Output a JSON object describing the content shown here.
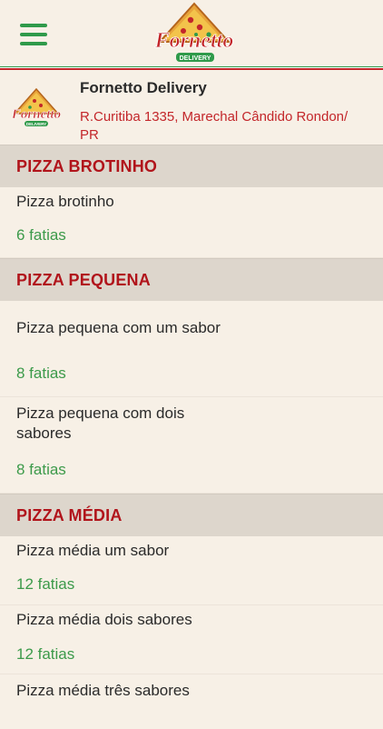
{
  "header": {
    "menu_icon": "hamburger-icon",
    "brand_name": "Fornetto",
    "brand_tag": "DELIVERY",
    "colors": {
      "green": "#2f9a4a",
      "red": "#c3262a",
      "background": "#f7f0e6"
    }
  },
  "store": {
    "name": "Fornetto Delivery",
    "address": "R.Curitiba 1335, Marechal Cândido Rondon/ PR",
    "logo_brand": "Fornetto",
    "logo_tag": "DELIVERY"
  },
  "sections": [
    {
      "title": "PIZZA BROTINHO",
      "items": [
        {
          "name": "Pizza brotinho",
          "slices": "6 fatias"
        }
      ]
    },
    {
      "title": "PIZZA PEQUENA",
      "items": [
        {
          "name": "Pizza pequena com um sabor",
          "slices": "8 fatias"
        },
        {
          "name": "Pizza pequena com dois sabores",
          "slices": "8 fatias"
        }
      ]
    },
    {
      "title": "PIZZA MÉDIA",
      "items": [
        {
          "name": "Pizza média um sabor",
          "slices": "12 fatias"
        },
        {
          "name": "Pizza média dois sabores",
          "slices": "12 fatias"
        },
        {
          "name": "Pizza média três sabores",
          "slices": ""
        }
      ]
    }
  ]
}
